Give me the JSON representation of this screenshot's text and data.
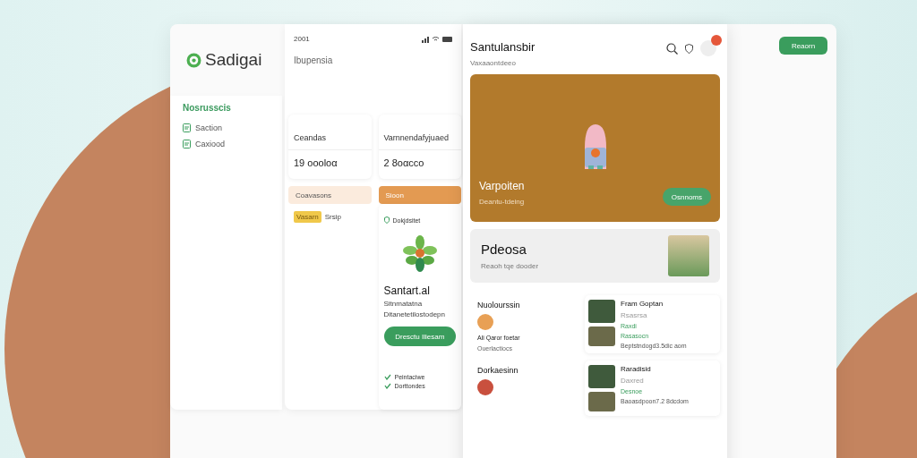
{
  "brand": {
    "name": "Sadigai"
  },
  "sidebar": {
    "heading": "Nosrusscis",
    "items": [
      {
        "label": "Saction",
        "selected": false
      },
      {
        "label": "Caxiood",
        "selected": false
      }
    ]
  },
  "phone_left": {
    "time": "2001",
    "title": "Ibupensia",
    "stats": [
      {
        "label": "Ceandas",
        "value": "19 oooloα"
      },
      {
        "label": "Varnnendafyjuaed",
        "value": "2 8oαcco"
      }
    ],
    "tabs": [
      {
        "label": "Coavasons",
        "selected": false
      },
      {
        "label": "Sioon",
        "selected": true
      }
    ],
    "tag": {
      "label": "Vasarn",
      "note": "Srsip"
    },
    "plant": {
      "status": "Dokjdsitet",
      "title": "Santart.al",
      "line_1": "Sitnmatatna",
      "line_2": "Ditanetetilostodepn",
      "button": "Dresctu Iliesam"
    },
    "checks": [
      {
        "label": "Peintaciwe",
        "checked": true
      },
      {
        "label": "Dorttondes",
        "checked": true
      }
    ]
  },
  "phone_right": {
    "title": "Santulansbir",
    "subtitle": "Vaxaaontdeeo",
    "hero": {
      "title": "Varpoiten",
      "subtitle": "Deantu-tdeing",
      "button": "Osnnoms"
    },
    "promo": {
      "title": "Pdeosa",
      "subtitle": "Reaoh tqe dooder"
    },
    "people": [
      {
        "heading": "Nuolourssin",
        "name": "Ali Qaror foetar",
        "detail": "Ouerlactiocs",
        "color": "#e8a055"
      },
      {
        "heading": "Dorkaesinn",
        "color": "#c9503e"
      }
    ],
    "cards": [
      {
        "title": "Fram Goptan",
        "meta": "Rsasrsa",
        "tags": [
          "Raxdi",
          "Rasasocn"
        ],
        "footer": "Beptstndogd3.5dic aom"
      },
      {
        "title": "Raradisid",
        "meta": "Daxred",
        "tags": [
          "Desnoe"
        ],
        "footer": "Baoasdpoon7.2 8dcdom"
      }
    ]
  },
  "action_button": "Reaorn"
}
